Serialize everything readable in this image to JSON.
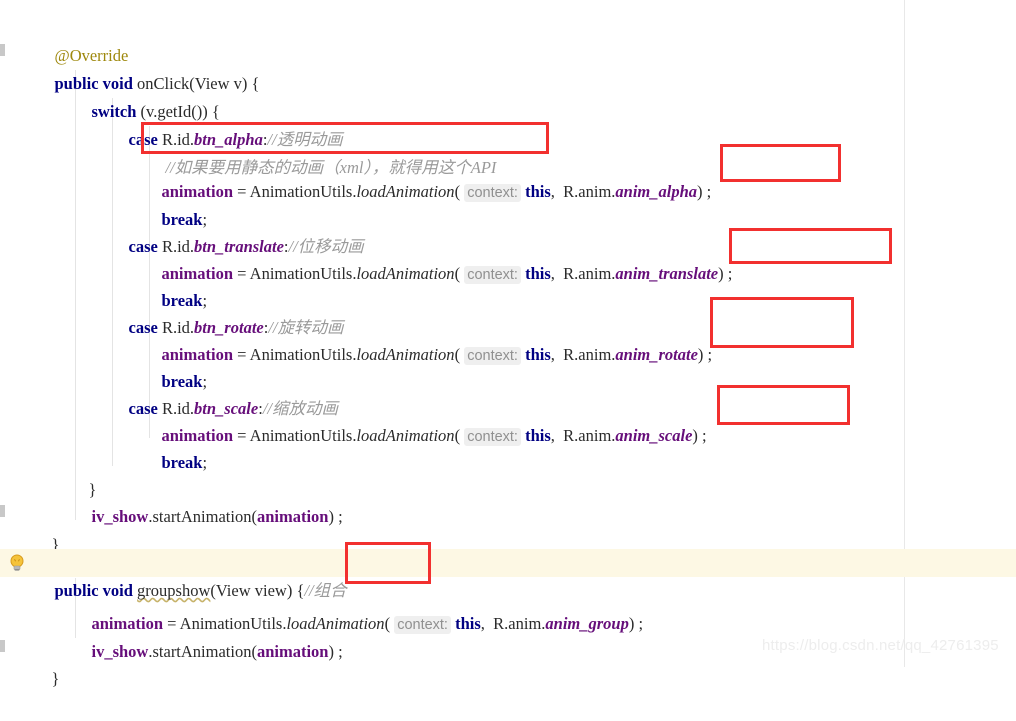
{
  "editor": {
    "background_color": "#ffffff",
    "highlight_line_color": "#fdf8e4",
    "annotation_box_color": "#f2302f",
    "keyword_color": "#000082",
    "field_color": "#660e7a",
    "comment_color": "#9a9a9a",
    "annotation_color": "#9e880d",
    "margin_guide_color": "#e8e8e8"
  },
  "watermark": {
    "text": "https://blog.csdn.net/qq_42761395"
  },
  "icons": {
    "intention_bulb": "lightbulb-icon"
  },
  "code": {
    "line_01": {
      "annotation": "@Override"
    },
    "line_02": {
      "kw1": "public",
      "kw2": "void",
      "name": "onClick",
      "params": "(View v) {"
    },
    "line_03": {
      "kw": "switch",
      "rest": " (v.getId()) {"
    },
    "line_04": {
      "kw": "case",
      "ref": " R.id.",
      "field": "btn_alpha",
      "colon": ":",
      "comment": "//透明动画"
    },
    "line_05": {
      "comment": "//如果要用静态的动画（xml），就得用这个API"
    },
    "line_06": {
      "var": "animation",
      "eq": " = ",
      "cls": "AnimationUtils.",
      "method": "loadAnimation",
      "open": "( ",
      "hint": "context:",
      "this": "this",
      "sep": ",  R.anim.",
      "field": "anim_alpha",
      "close": ") ;"
    },
    "line_07": {
      "kw": "break",
      "semi": ";"
    },
    "line_08": {
      "kw": "case",
      "ref": " R.id.",
      "field": "btn_translate",
      "colon": ":",
      "comment": "//位移动画"
    },
    "line_09": {
      "var": "animation",
      "eq": " = ",
      "cls": "AnimationUtils.",
      "method": "loadAnimation",
      "open": "( ",
      "hint": "context:",
      "this": "this",
      "sep": ",  R.anim.",
      "field": "anim_translate",
      "close": ") ;"
    },
    "line_10": {
      "kw": "break",
      "semi": ";"
    },
    "line_11": {
      "kw": "case",
      "ref": " R.id.",
      "field": "btn_rotate",
      "colon": ":",
      "comment": "//旋转动画"
    },
    "line_12": {
      "var": "animation",
      "eq": " = ",
      "cls": "AnimationUtils.",
      "method": "loadAnimation",
      "open": "( ",
      "hint": "context:",
      "this": "this",
      "sep": ",  R.anim.",
      "field": "anim_rotate",
      "close": ") ;"
    },
    "line_13": {
      "kw": "break",
      "semi": ";"
    },
    "line_14": {
      "kw": "case",
      "ref": " R.id.",
      "field": "btn_scale",
      "colon": ":",
      "comment": "//缩放动画"
    },
    "line_15": {
      "var": "animation",
      "eq": " = ",
      "cls": "AnimationUtils.",
      "method": "loadAnimation",
      "open": "( ",
      "hint": "context:",
      "this": "this",
      "sep": ",  R.anim.",
      "field": "anim_scale",
      "close": ") ;"
    },
    "line_16": {
      "kw": "break",
      "semi": ";"
    },
    "line_17": {
      "brace": "}"
    },
    "line_18": {
      "var": "iv_show",
      "dot": ".",
      "method": "startAnimation",
      "open": "(",
      "arg": "animation",
      "close": ") ;"
    },
    "line_19": {
      "brace": "}"
    },
    "line_20": {
      "kw1": "public",
      "kw2": "void",
      "name": "groupshow",
      "params": "(View view) ",
      "brace": "{",
      "comment": "//组合"
    },
    "line_21": {
      "var": "animation",
      "eq": " = ",
      "cls": "AnimationUtils.",
      "method": "loadAnimation",
      "open": "( ",
      "hint": "context:",
      "this": "this",
      "sep": ",  R.anim.",
      "field": "anim_group",
      "close": ") ;"
    },
    "line_22": {
      "var": "iv_show",
      "dot": ".",
      "method": "startAnimation",
      "open": "(",
      "arg": "animation",
      "close": ") ;"
    },
    "line_23": {
      "brace": "}"
    }
  },
  "annotation_boxes": [
    {
      "name": "redbox-static-anim-comment",
      "label": "//如果要用静态的动画（xml），就得用这个API"
    },
    {
      "name": "redbox-anim-alpha",
      "label": "anim_alpha) ;"
    },
    {
      "name": "redbox-anim-translate",
      "label": "anim_translate) ;"
    },
    {
      "name": "redbox-anim-rotate",
      "label": ". anim_rotate) ;"
    },
    {
      "name": "redbox-anim-scale",
      "label": "anim_scale) ;"
    },
    {
      "name": "redbox-group-comment",
      "label": "{//组合"
    }
  ]
}
